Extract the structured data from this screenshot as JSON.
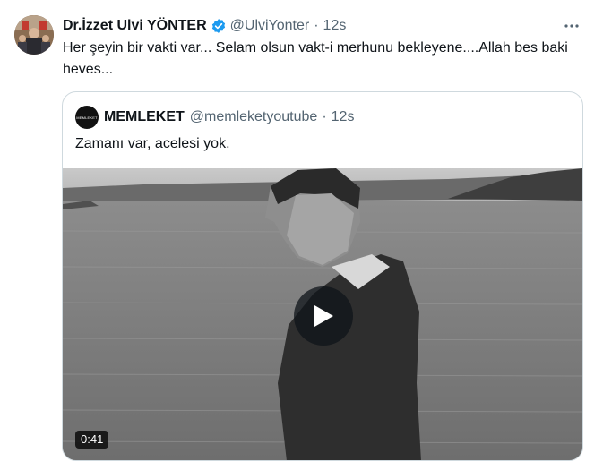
{
  "tweet": {
    "author_name": "Dr.İzzet Ulvi YÖNTER",
    "handle": "@UlviYonter",
    "separator": "·",
    "time": "12s",
    "text": "Her şeyin bir vakti var... Selam olsun vakt-i merhunu bekleyene....Allah bes baki heves...",
    "more_icon": "more-horizontal-icon",
    "verified_color": "#1d9bf0"
  },
  "quote": {
    "author_name": "MEMLEKET",
    "avatar_text": "MEMLEKET",
    "handle": "@memleketyoutube",
    "separator": "·",
    "time": "12s",
    "text": "Zamanı var, acelesi yok.",
    "video": {
      "duration": "0:41",
      "play_icon": "play-icon"
    }
  }
}
